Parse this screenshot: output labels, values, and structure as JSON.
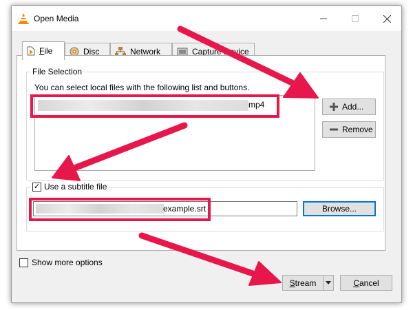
{
  "window": {
    "title": "Open Media",
    "icon": "vlc-cone-icon",
    "controls": {
      "minimize": "minimize-icon",
      "maximize": "maximize-icon",
      "close": "close-icon"
    }
  },
  "tabs": [
    {
      "icon": "file-icon",
      "label": "File",
      "accel": "F",
      "active": true
    },
    {
      "icon": "disc-icon",
      "label": "Disc",
      "accel": "D",
      "active": false
    },
    {
      "icon": "network-icon",
      "label": "Network",
      "accel": "N",
      "active": false
    },
    {
      "icon": "capture-device-icon",
      "label": "Capture Device",
      "active": false
    }
  ],
  "file_selection": {
    "group_title": "File Selection",
    "hint": "You can select local files with the following list and buttons.",
    "selected_file_suffix": "mp4",
    "add_button": {
      "icon": "plus-icon",
      "label": "Add...",
      "accel": "A"
    },
    "remove_button": {
      "icon": "minus-icon",
      "label": "Remove",
      "accel": "R"
    }
  },
  "subtitle": {
    "checkbox_label": "Use a subtitle file",
    "checked": true,
    "file_suffix": "example.srt",
    "browse_button": "Browse..."
  },
  "footer": {
    "show_more_options": "Show more options",
    "show_more_checked": false,
    "stream_button": "Stream",
    "stream_accel": "S",
    "dropdown_icon": "dropdown-arrow-icon",
    "cancel_button": "Cancel",
    "cancel_accel": "C"
  },
  "annotation_color": "#e8174b"
}
